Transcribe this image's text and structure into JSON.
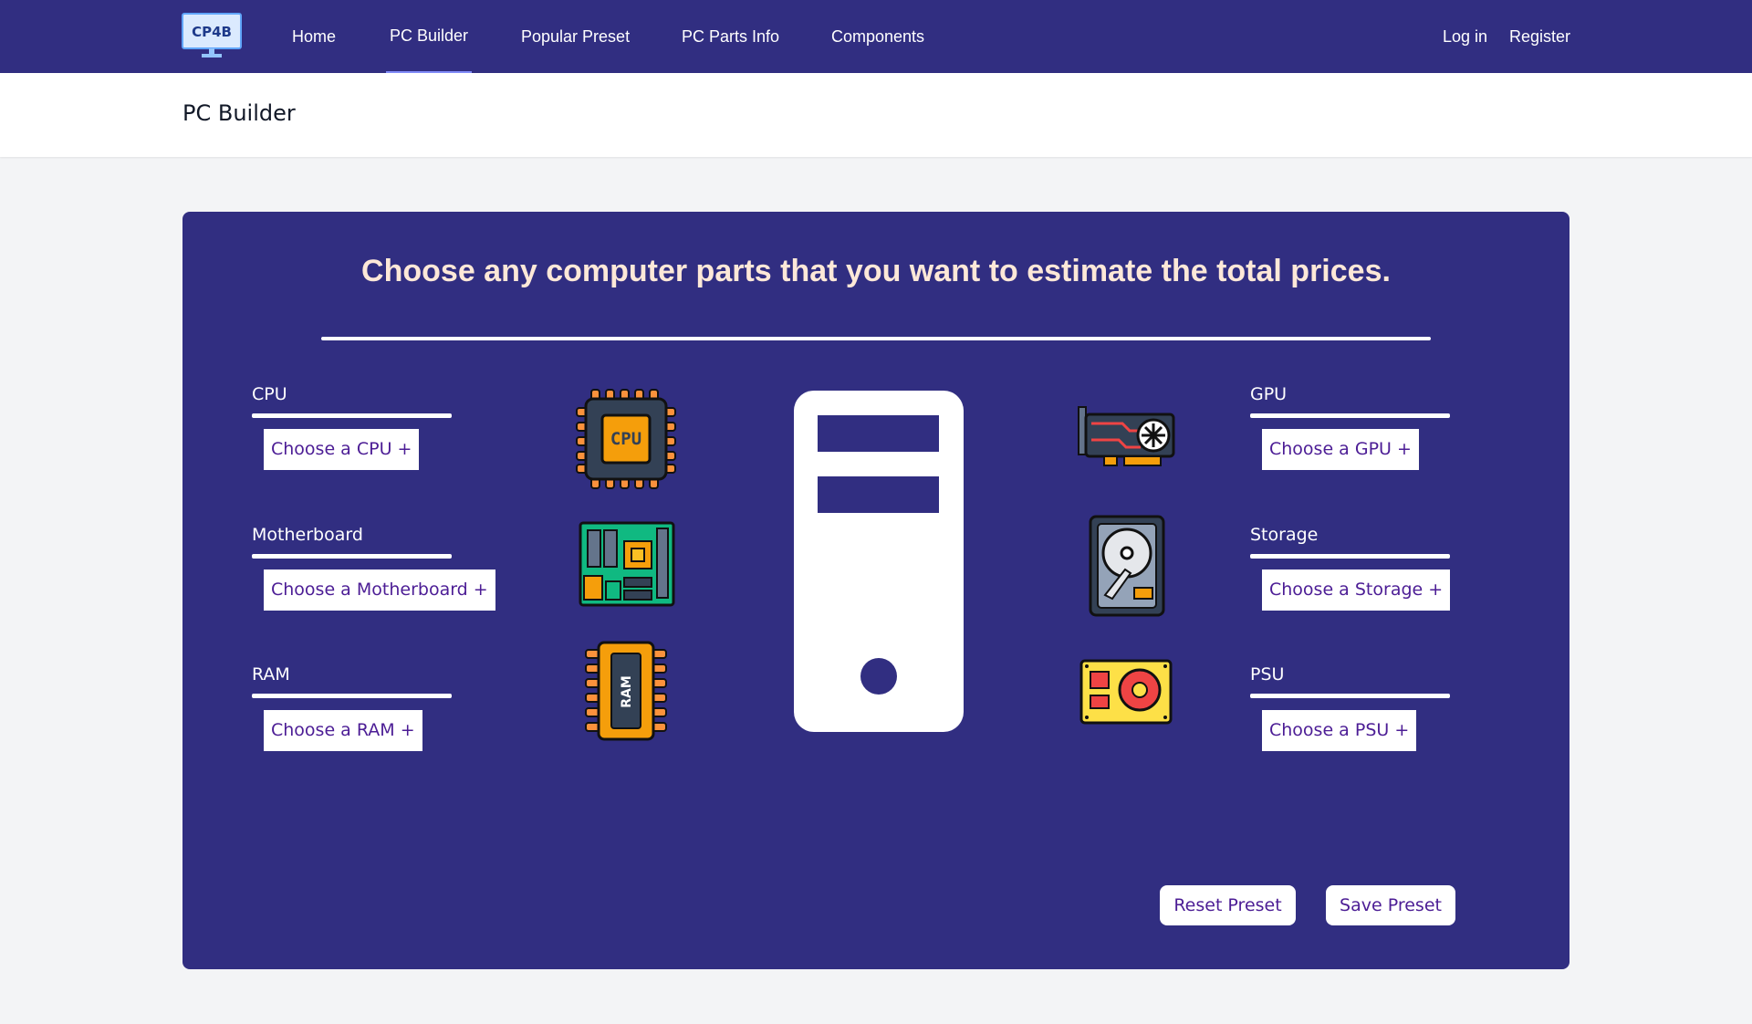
{
  "nav": {
    "logo_text": "CP4B",
    "links": [
      "Home",
      "PC Builder",
      "Popular Preset",
      "PC Parts Info",
      "Components"
    ],
    "login": "Log in",
    "register": "Register"
  },
  "header": {
    "title": "PC Builder"
  },
  "panel": {
    "heading": "Choose any computer parts that you want to estimate the total prices.",
    "parts": {
      "cpu": {
        "label": "CPU",
        "button": "Choose a CPU +",
        "icon_text": "CPU"
      },
      "motherboard": {
        "label": "Motherboard",
        "button": "Choose a Motherboard +"
      },
      "ram": {
        "label": "RAM",
        "button": "Choose a RAM +",
        "icon_text": "RAM"
      },
      "gpu": {
        "label": "GPU",
        "button": "Choose a GPU +"
      },
      "storage": {
        "label": "Storage",
        "button": "Choose a Storage +"
      },
      "psu": {
        "label": "PSU",
        "button": "Choose a PSU +"
      }
    },
    "reset_button": "Reset Preset",
    "save_button": "Save Preset"
  },
  "colors": {
    "brand": "#312e81",
    "heading_text": "#fde8d8",
    "button_text": "#4c1d95"
  }
}
